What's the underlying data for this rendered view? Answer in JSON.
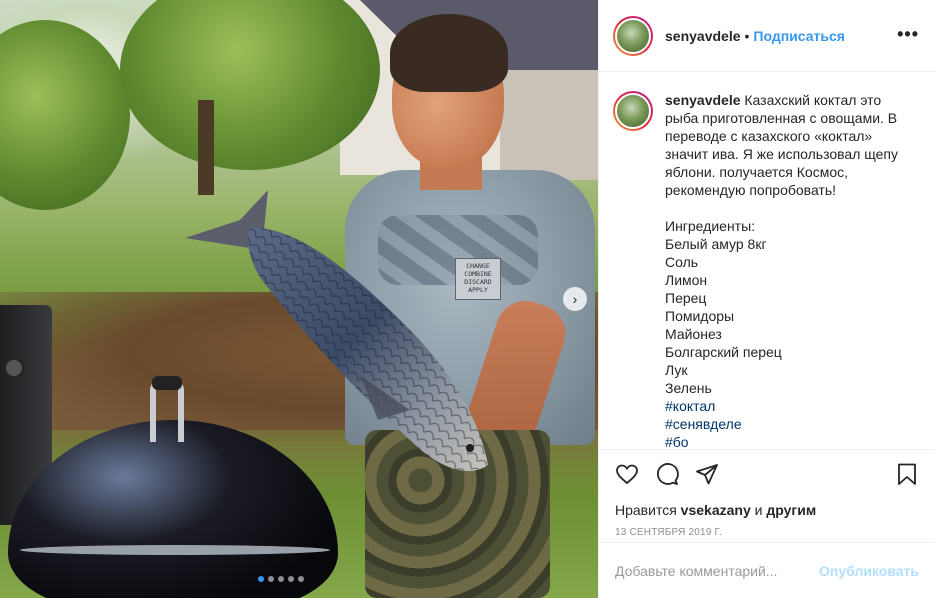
{
  "post": {
    "username": "senyavdele",
    "follow_label": "Подписаться",
    "bullet": "•",
    "more_label": "•••",
    "caption_lines": [
      "Казахский коктал это",
      "рыба приготовленная с овощами. В",
      "переводе с казахского «коктал»",
      "значит ива. Я же использовал щепу",
      "яблони. получается Космос,",
      "рекомендую попробовать!"
    ],
    "ingredients_title": "Ингредиенты:",
    "ingredients": [
      "Белый амур 8кг",
      "Соль",
      "Лимон",
      "Перец",
      "Помидоры",
      "Майонез",
      "Болгарский перец",
      "Лук",
      "Зелень"
    ],
    "hashtags": [
      "#коктал",
      "#сенявделе",
      "#бо"
    ],
    "likes_prefix": "Нравится",
    "likes_user": "vsekazany",
    "likes_and": "и",
    "likes_others": "другим",
    "date": "13 сентября 2019 г.",
    "comment_placeholder": "Добавьте комментарий...",
    "publish_label": "Опубликовать",
    "next_arrow": "›"
  },
  "photo": {
    "shirt_text": "CHANGE COMBINE DISCARD APPLY",
    "carousel_dots": 5,
    "active_dot": 0
  },
  "icons": {
    "like": "heart-icon",
    "comment": "comment-bubble-icon",
    "share": "paper-plane-icon",
    "save": "bookmark-icon",
    "more": "ellipsis-icon"
  },
  "colors": {
    "link_blue": "#3897f0",
    "hashtag": "#003569",
    "publish_disabled": "#b2dffc",
    "muted": "#8e8e8e"
  }
}
